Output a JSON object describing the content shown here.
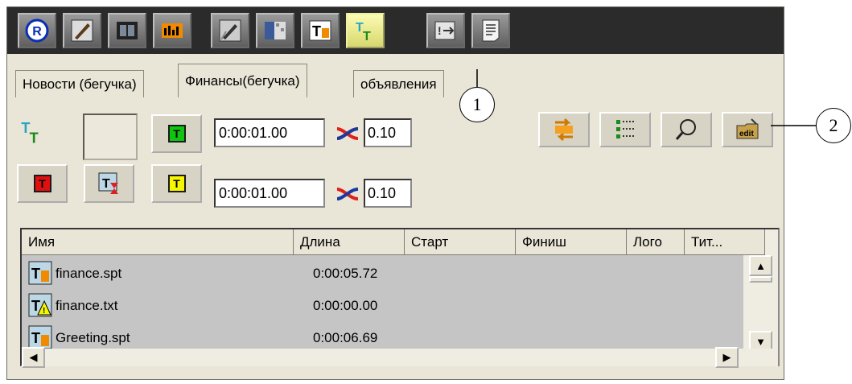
{
  "toolbar": {
    "buttons": [
      {
        "icon": "registered-icon"
      },
      {
        "icon": "edit-brush-icon"
      },
      {
        "icon": "film-icon"
      },
      {
        "icon": "equalizer-icon"
      },
      {
        "icon": "edit-pen-icon"
      },
      {
        "icon": "film-grid-icon"
      },
      {
        "icon": "text-file-icon"
      },
      {
        "icon": "text-crawl-icon",
        "active": true
      },
      {
        "icon": "export-icon"
      },
      {
        "icon": "document-icon"
      }
    ]
  },
  "tabs": [
    {
      "label": "Новости (бегучка)"
    },
    {
      "label": "Финансы(бегучка)",
      "active": true
    },
    {
      "label": "объявления"
    }
  ],
  "controls": {
    "time1": "0:00:01.00",
    "mix1": "0.10",
    "time2": "0:00:01.00",
    "mix2": "0.10"
  },
  "table": {
    "columns": [
      "Имя",
      "Длина",
      "Старт",
      "Финиш",
      "Лого",
      "Тит..."
    ],
    "rows": [
      {
        "name": "finance.spt",
        "length": "0:00:05.72"
      },
      {
        "name": "finance.txt",
        "length": "0:00:00.00"
      },
      {
        "name": "Greeting.spt",
        "length": "0:00:06.69"
      }
    ]
  },
  "callouts": [
    "1",
    "2"
  ],
  "colors": {
    "toolbar_bg": "#2b2b2b",
    "panel_bg": "#e9e6d7",
    "active_btn": "#f0f0a0"
  }
}
